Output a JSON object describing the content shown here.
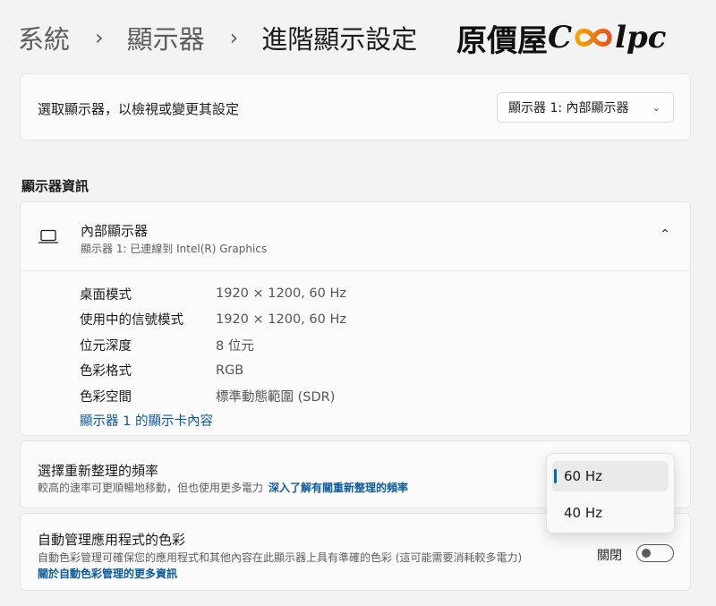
{
  "breadcrumb": {
    "items": [
      "系統",
      "顯示器",
      "進階顯示設定"
    ],
    "separator": "›"
  },
  "logo": {
    "prefix": "原價屋",
    "cool": "C",
    "suffix": "lpc"
  },
  "display_select": {
    "label": "選取顯示器，以檢視或變更其設定",
    "value": "顯示器 1: 內部顯示器"
  },
  "display_info": {
    "section_title": "顯示器資訊",
    "name": "內部顯示器",
    "subtitle": "顯示器 1: 已連線到 Intel(R) Graphics",
    "rows": [
      {
        "key": "桌面模式",
        "value": "1920 × 1200, 60 Hz"
      },
      {
        "key": "使用中的信號模式",
        "value": "1920 × 1200, 60 Hz"
      },
      {
        "key": "位元深度",
        "value": "8 位元"
      },
      {
        "key": "色彩格式",
        "value": "RGB"
      },
      {
        "key": "色彩空間",
        "value": "標準動態範圍 (SDR)"
      }
    ],
    "adapter_link": "顯示器 1 的顯示卡內容"
  },
  "refresh_rate": {
    "title": "選擇重新整理的頻率",
    "description": "較高的速率可更順暢地移動，但也使用更多電力",
    "link": "深入了解有關重新整理的頻率",
    "options": [
      "60 Hz",
      "40 Hz"
    ],
    "selected": "60 Hz"
  },
  "auto_color": {
    "title": "自動管理應用程式的色彩",
    "description": "自動色彩管理可確保您的應用程式和其他內容在此顯示器上具有準確的色彩 (這可能需要消耗較多電力)",
    "link": "關於自動色彩管理的更多資訊",
    "state": "關閉",
    "enabled": false
  },
  "colors": {
    "accent": "#0067c0",
    "link": "#0a5a9c",
    "background": "#f3f3f3",
    "card": "#fbfbfb"
  },
  "icons": {
    "display": "laptop-icon",
    "dropdown": "chevron-down-icon",
    "collapse": "chevron-up-icon"
  }
}
